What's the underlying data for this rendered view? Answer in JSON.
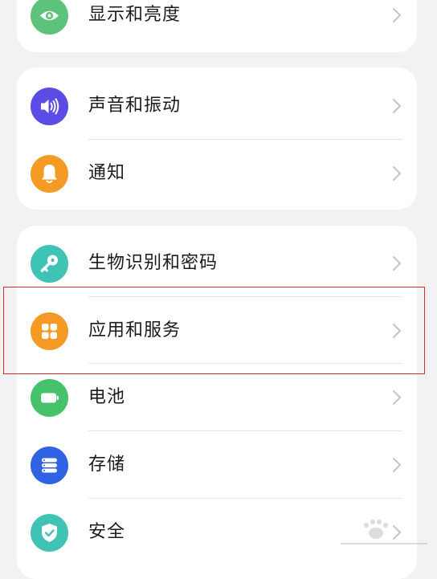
{
  "colors": {
    "display": "#5dc27a",
    "sound": "#5b4ce6",
    "notifications": "#f59b25",
    "biometrics": "#3fc3b5",
    "apps": "#f59b25",
    "battery": "#45c26a",
    "storage": "#2f63e3",
    "security": "#3fc3b5",
    "highlight": "#e0292f"
  },
  "groups": [
    {
      "items": [
        {
          "label": "显示和亮度",
          "icon": "eye-icon"
        }
      ]
    },
    {
      "items": [
        {
          "label": "声音和振动",
          "icon": "speaker-icon"
        },
        {
          "label": "通知",
          "icon": "bell-icon"
        }
      ]
    },
    {
      "items": [
        {
          "label": "生物识别和密码",
          "icon": "key-icon"
        },
        {
          "label": "应用和服务",
          "icon": "app-grid-icon"
        },
        {
          "label": "电池",
          "icon": "battery-icon"
        },
        {
          "label": "存储",
          "icon": "storage-icon"
        },
        {
          "label": "安全",
          "icon": "shield-icon"
        }
      ]
    }
  ]
}
